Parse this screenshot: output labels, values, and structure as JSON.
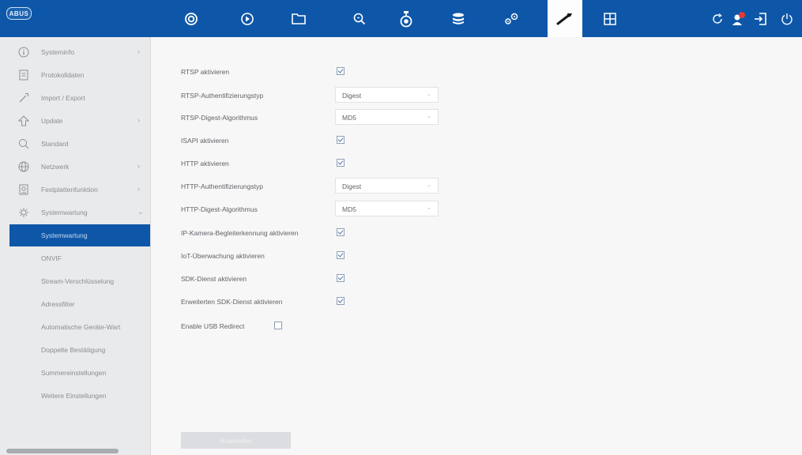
{
  "brand": {
    "logo_text": "ABUS",
    "accent": "#0e57a8"
  },
  "toolbar": {
    "icons": [
      "live-view-icon",
      "playback-icon",
      "folder-icon",
      "search-icon",
      "camera-icon",
      "storage-icon",
      "settings-icon",
      "tools-icon",
      "grid-icon"
    ],
    "active": "tools-icon",
    "right_icons": [
      "refresh-icon",
      "user-alert-icon",
      "logout-icon",
      "power-icon"
    ]
  },
  "sidebar": {
    "items": [
      {
        "label": "Systeminfo",
        "icon": "info-icon",
        "has_sub": true
      },
      {
        "label": "Protokolldaten",
        "icon": "log-icon",
        "has_sub": false
      },
      {
        "label": "Import / Export",
        "icon": "import-export-icon",
        "has_sub": false
      },
      {
        "label": "Update",
        "icon": "update-icon",
        "has_sub": true
      },
      {
        "label": "Standard",
        "icon": "default-icon",
        "has_sub": false
      },
      {
        "label": "Netzwerk",
        "icon": "network-icon",
        "has_sub": true
      },
      {
        "label": "Festplattenfunktion",
        "icon": "hdd-icon",
        "has_sub": true
      },
      {
        "label": "Systemwartung",
        "icon": "maintenance-icon",
        "has_sub": true,
        "expanded": true
      }
    ],
    "sub_items": [
      {
        "label": "Systemwartung",
        "active": true
      },
      {
        "label": "ONVIF",
        "active": false
      },
      {
        "label": "Stream-Verschlüsselung",
        "active": false
      },
      {
        "label": "Adressfilter",
        "active": false
      },
      {
        "label": "Automatische Geräte-Wart",
        "active": false
      },
      {
        "label": "Doppelte Bestätigung",
        "active": false
      },
      {
        "label": "Summereinstellungen",
        "active": false
      },
      {
        "label": "Weitere Einstellungen",
        "active": false
      }
    ]
  },
  "settings": [
    {
      "label": "RTSP aktivieren",
      "type": "checkbox",
      "checked": true
    },
    {
      "label": "RTSP-Authentifizierungstyp",
      "type": "select",
      "value": "Digest"
    },
    {
      "label": "RTSP-Digest-Algorithmus",
      "type": "select",
      "value": "MD5"
    },
    {
      "label": "ISAPI aktivieren",
      "type": "checkbox",
      "checked": true
    },
    {
      "label": "HTTP aktivieren",
      "type": "checkbox",
      "checked": true
    },
    {
      "label": "HTTP-Authentifizierungstyp",
      "type": "select",
      "value": "Digest"
    },
    {
      "label": "HTTP-Digest-Algorithmus",
      "type": "select",
      "value": "MD5"
    },
    {
      "label": "IP-Kamera-Begleiterkennung aktivieren",
      "type": "checkbox",
      "checked": true
    },
    {
      "label": "IoT-Überwachung aktivieren",
      "type": "checkbox",
      "checked": true
    },
    {
      "label": "SDK-Dienst aktivieren",
      "type": "checkbox",
      "checked": true
    },
    {
      "label": "Erweiterten SDK-Dienst aktivieren",
      "type": "checkbox",
      "checked": true
    },
    {
      "label": "Enable USB Redirect",
      "type": "checkbox",
      "checked": false
    }
  ],
  "apply_label": "Anwenden"
}
